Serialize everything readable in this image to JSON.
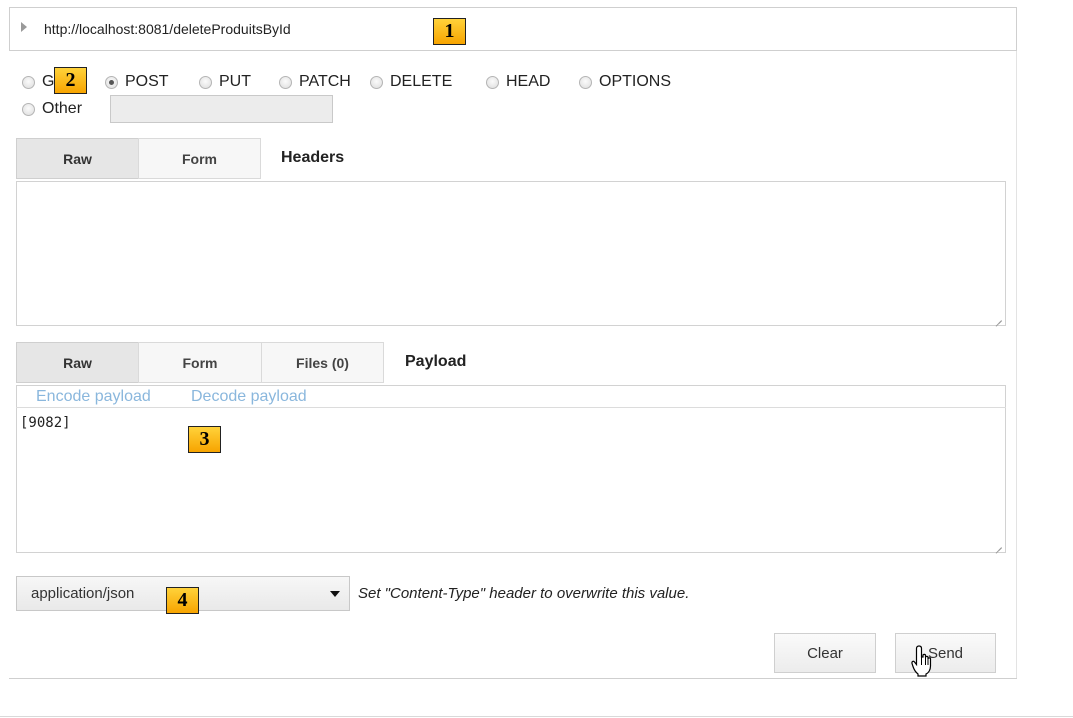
{
  "url_bar": {
    "value": "http://localhost:8081/deleteProduitsById"
  },
  "badges": [
    "1",
    "2",
    "3",
    "4"
  ],
  "methods": [
    {
      "label": "G",
      "checked": false
    },
    {
      "label": "POST",
      "checked": true
    },
    {
      "label": "PUT",
      "checked": false
    },
    {
      "label": "PATCH",
      "checked": false
    },
    {
      "label": "DELETE",
      "checked": false
    },
    {
      "label": "HEAD",
      "checked": false
    },
    {
      "label": "OPTIONS",
      "checked": false
    },
    {
      "label": "Other",
      "checked": false
    }
  ],
  "headers_section": {
    "tabs": [
      "Raw",
      "Form"
    ],
    "title": "Headers"
  },
  "payload_section": {
    "tabs": [
      "Raw",
      "Form",
      "Files (0)"
    ],
    "title": "Payload",
    "encode_link": "Encode payload",
    "decode_link": "Decode payload",
    "content": "[9082]"
  },
  "content_type": {
    "selected": "application/json",
    "hint": "Set \"Content-Type\" header to overwrite this value."
  },
  "actions": {
    "clear": "Clear",
    "send": "Send"
  },
  "colors": {
    "link": "#8ab7dd",
    "badge": "#f7a400"
  }
}
